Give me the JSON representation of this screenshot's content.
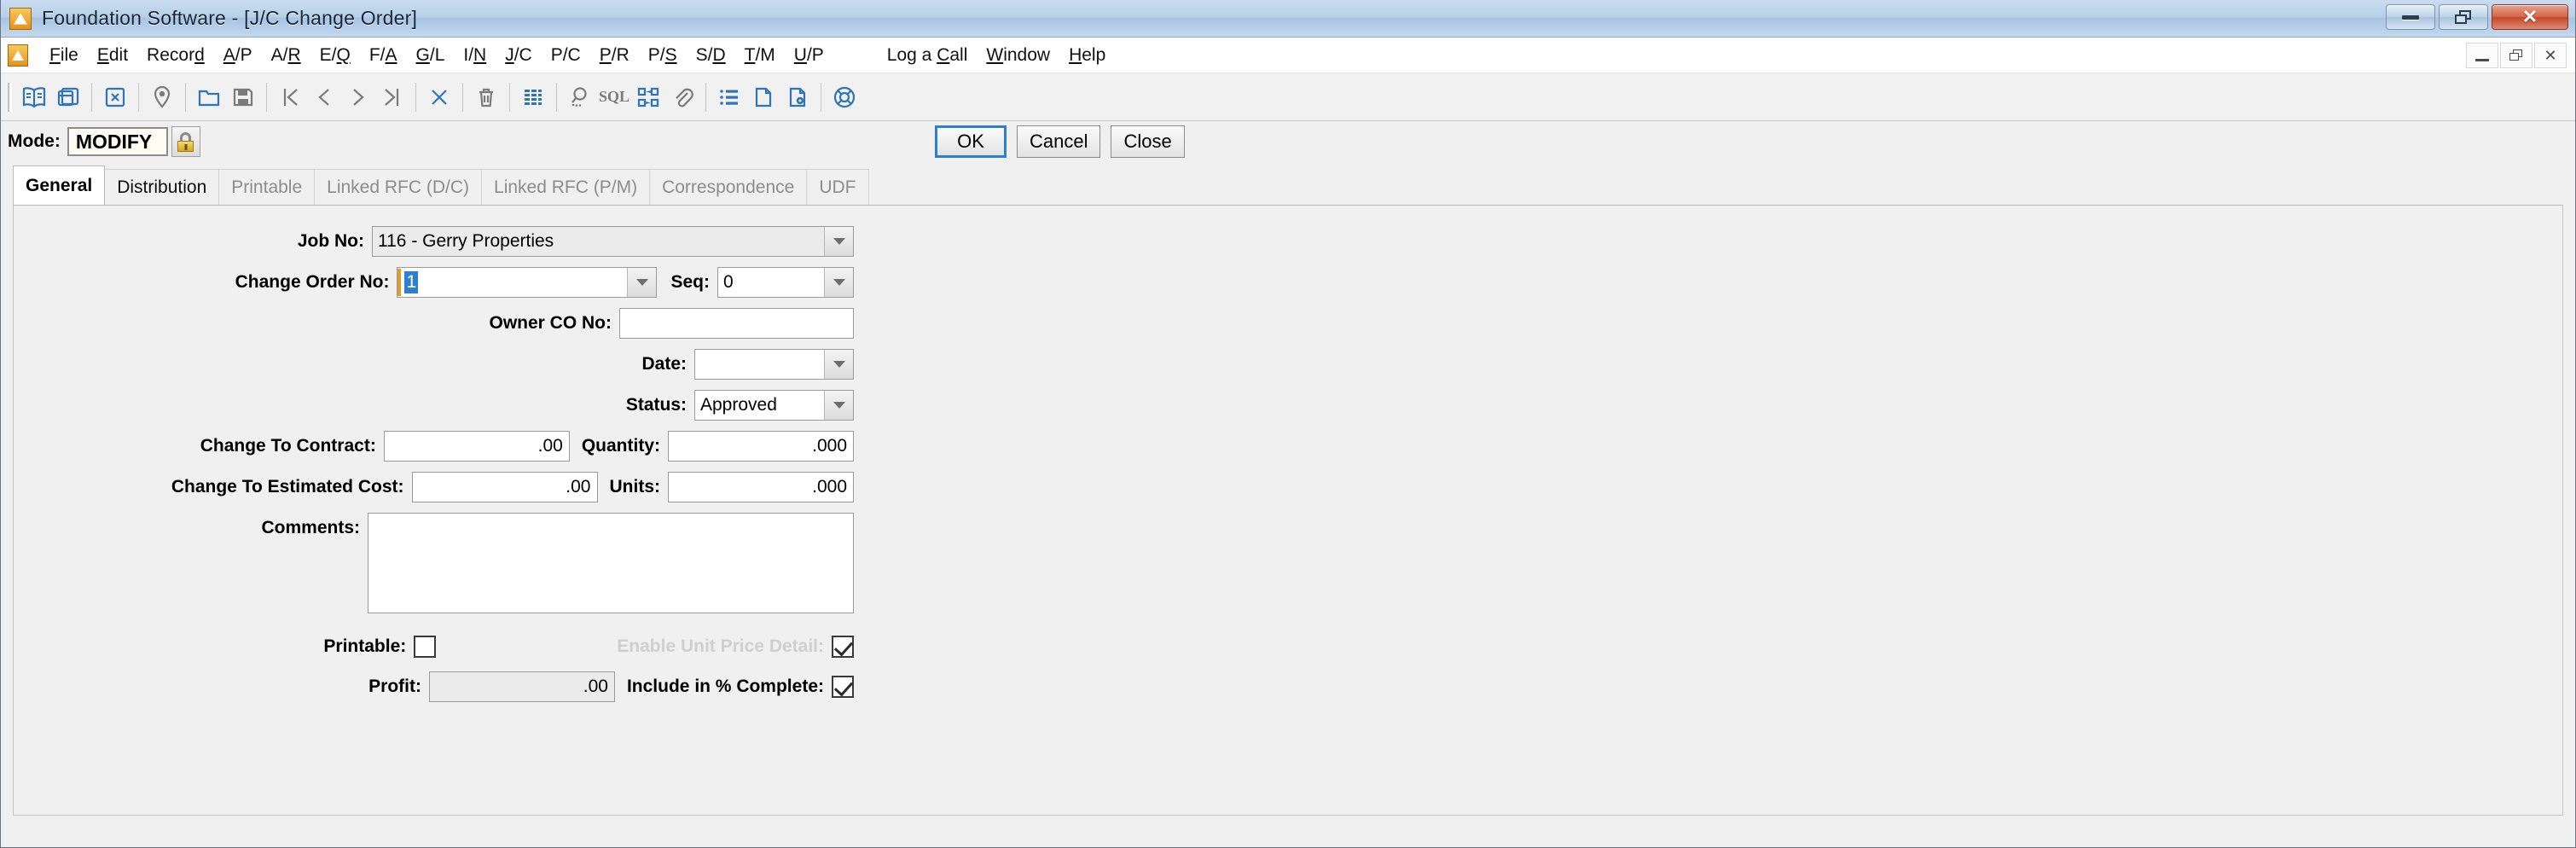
{
  "window": {
    "title": "Foundation Software - [J/C Change Order]",
    "app_icon": "foundation-logo-icon",
    "minimize_label": "Minimize",
    "restore_label": "Restore",
    "close_label": "Close"
  },
  "menubar": {
    "items": [
      {
        "label": "File",
        "accel": "F"
      },
      {
        "label": "Edit",
        "accel": "E"
      },
      {
        "label": "Record",
        "accel": "d"
      },
      {
        "label": "A/P",
        "accel": "A"
      },
      {
        "label": "A/R",
        "accel": "R"
      },
      {
        "label": "E/Q",
        "accel": "Q"
      },
      {
        "label": "F/A",
        "accel": "A"
      },
      {
        "label": "G/L",
        "accel": "G"
      },
      {
        "label": "I/N",
        "accel": "N"
      },
      {
        "label": "J/C",
        "accel": "J"
      },
      {
        "label": "P/C",
        "accel": ""
      },
      {
        "label": "P/R",
        "accel": "P"
      },
      {
        "label": "P/S",
        "accel": "S"
      },
      {
        "label": "S/D",
        "accel": "D"
      },
      {
        "label": "T/M",
        "accel": "T"
      },
      {
        "label": "U/P",
        "accel": "U"
      },
      {
        "label": "Log a Call",
        "accel": "C"
      },
      {
        "label": "Window",
        "accel": "W"
      },
      {
        "label": "Help",
        "accel": "H"
      }
    ]
  },
  "toolbar": {
    "icons": [
      "book-open-icon",
      "cascade-windows-icon",
      "close-window-icon",
      "location-pin-icon",
      "new-folder-icon",
      "save-icon",
      "first-record-icon",
      "previous-record-icon",
      "next-record-icon",
      "last-record-icon",
      "delete-x-icon",
      "trash-icon",
      "grid-view-icon",
      "search-icon",
      "sql-icon",
      "workflow-icon",
      "attachment-icon",
      "list-icon",
      "document-icon",
      "document-settings-icon",
      "help-lifering-icon"
    ],
    "sql_label": "SQL"
  },
  "modebar": {
    "mode_label": "Mode:",
    "mode_value": "MODIFY",
    "lock_icon": "padlock-icon",
    "ok_label": "OK",
    "cancel_label": "Cancel",
    "close_label": "Close"
  },
  "tabs": [
    {
      "label": "General",
      "state": "active"
    },
    {
      "label": "Distribution",
      "state": "enabled"
    },
    {
      "label": "Printable",
      "state": "disabled"
    },
    {
      "label": "Linked RFC (D/C)",
      "state": "disabled"
    },
    {
      "label": "Linked RFC (P/M)",
      "state": "disabled"
    },
    {
      "label": "Correspondence",
      "state": "disabled"
    },
    {
      "label": "UDF",
      "state": "disabled"
    }
  ],
  "form": {
    "job_no": {
      "label": "Job No:",
      "value": "116 - Gerry Properties"
    },
    "change_order_no": {
      "label": "Change Order No:",
      "value": "1"
    },
    "seq": {
      "label": "Seq:",
      "value": "0"
    },
    "owner_co_no": {
      "label": "Owner CO No:",
      "value": ""
    },
    "date": {
      "label": "Date:",
      "value": ""
    },
    "status": {
      "label": "Status:",
      "value": "Approved"
    },
    "change_to_contract": {
      "label": "Change To Contract:",
      "value": ".00"
    },
    "quantity": {
      "label": "Quantity:",
      "value": ".000"
    },
    "change_to_estimated_cost": {
      "label": "Change To Estimated Cost:",
      "value": ".00"
    },
    "units": {
      "label": "Units:",
      "value": ".000"
    },
    "comments": {
      "label": "Comments:",
      "value": ""
    },
    "printable": {
      "label": "Printable:",
      "checked": false
    },
    "enable_unit_price_detail": {
      "label": "Enable Unit Price Detail:",
      "checked": true
    },
    "profit": {
      "label": "Profit:",
      "value": ".00"
    },
    "include_in_pct_complete": {
      "label": "Include in % Complete:",
      "checked": true
    }
  },
  "colors": {
    "accent_blue": "#2f74b5",
    "focus_blue": "#2f7fd1",
    "selection_blue": "#2f7fd1",
    "lock_gold": "#d8a71c",
    "close_red": "#c4472c",
    "panel_grey": "#f0f0f0"
  }
}
